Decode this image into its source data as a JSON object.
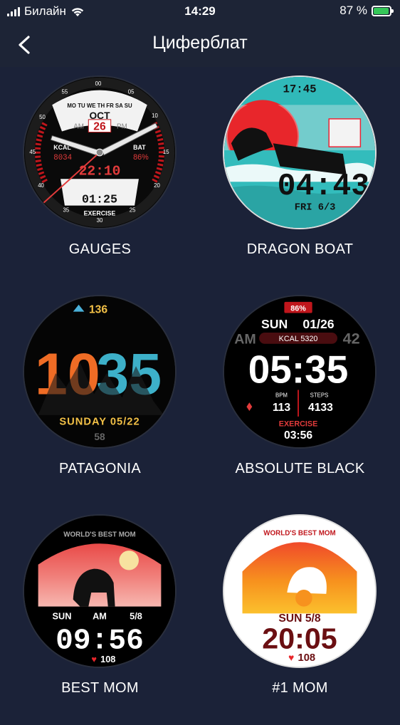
{
  "status_bar": {
    "carrier": "Билайн",
    "time": "14:29",
    "battery": "87 %",
    "battery_level": 0.87
  },
  "nav": {
    "title": "Циферблат"
  },
  "faces": [
    {
      "name": "GAUGES",
      "texts": {
        "days": "MO TU WE TH FR SA SU",
        "month": "OCT",
        "am": "AM",
        "pm": "PM",
        "date": "26",
        "kcal_label": "KCAL",
        "kcal_value": "8034",
        "bat_label": "BAT",
        "bat_value": "86%",
        "digital_time": "22:10",
        "timer": "01:25",
        "mode": "EXERCISE",
        "n00": "00",
        "n05": "05",
        "n10": "10",
        "n15": "15",
        "n20": "20",
        "n25": "25",
        "n30": "30",
        "n35": "35",
        "n40": "40",
        "n45": "45",
        "n50": "50",
        "n55": "55"
      }
    },
    {
      "name": "DRAGON BOAT",
      "texts": {
        "top_time": "17:45",
        "time": "04:43",
        "date": "FRI  6/3"
      }
    },
    {
      "name": "PATAGONIA",
      "texts": {
        "top": "136",
        "hours": "10",
        "minutes": "35",
        "date": "SUNDAY 05/22",
        "bottom": "58"
      }
    },
    {
      "name": "ABSOLUTE BLACK",
      "texts": {
        "battery": "86%",
        "day": "SUN",
        "date": "01/26",
        "am": "AM",
        "seconds": "42",
        "kcal": "KCAL 5320",
        "time": "05:35",
        "bpm_label": "BPM",
        "bpm": "113",
        "steps_label": "STEPS",
        "steps": "4133",
        "mode": "EXERCISE",
        "timer": "03:56"
      }
    },
    {
      "name": "BEST MOM",
      "texts": {
        "arc": "WORLD'S BEST MOM",
        "day": "SUN",
        "am": "AM",
        "date": "5/8",
        "time": "09:56",
        "heart": "108"
      }
    },
    {
      "name": "#1 MOM",
      "texts": {
        "arc": "WORLD'S BEST MOM",
        "date": "SUN  5/8",
        "time": "20:05",
        "heart": "108"
      }
    }
  ]
}
